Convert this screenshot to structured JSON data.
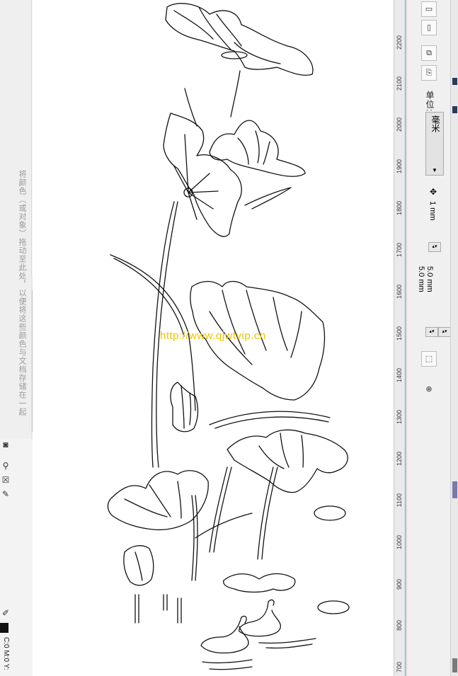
{
  "left_panel": {
    "hint": "将颜色（或对象）拖动至此处，以便将这些颜色与文档存储在一起",
    "tools": [
      "camera-icon",
      "fill-bucket-icon",
      "no-fill-icon",
      "pen-icon"
    ],
    "status": "C:0 M:0 Y:"
  },
  "canvas": {
    "watermark": "http://www.qjwtvip.cn"
  },
  "ruler": {
    "labels": [
      "2200",
      "2100",
      "2000",
      "1900",
      "1800",
      "1700",
      "1600",
      "1500",
      "1400",
      "1300",
      "1200",
      "1100",
      "1000",
      "900",
      "800",
      "700"
    ]
  },
  "properties": {
    "units_label": "单位:",
    "units_value": "毫米",
    "nudge_value": "1 mm",
    "duplicate_x": "5.0 mm",
    "duplicate_y": "5.0 mm"
  },
  "colors": {
    "ruler_guide": "#35b6e0",
    "watermark": "#f2c200"
  }
}
